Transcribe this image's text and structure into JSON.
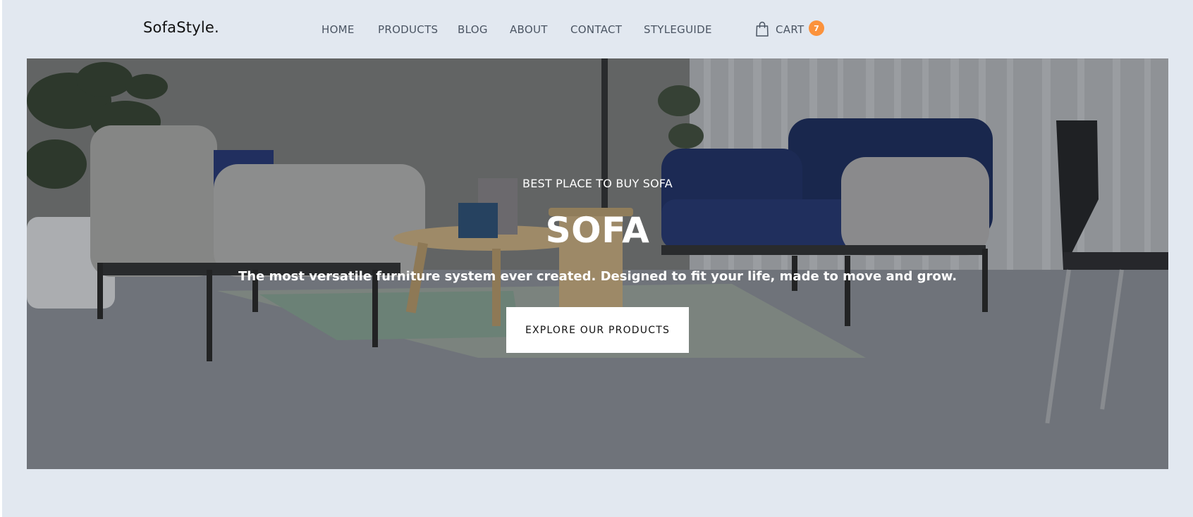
{
  "brand": {
    "logo": "SofaStyle."
  },
  "nav": {
    "items": [
      {
        "label": "HOME"
      },
      {
        "label": "PRODUCTS"
      },
      {
        "label": "BLOG"
      },
      {
        "label": "ABOUT"
      },
      {
        "label": "CONTACT"
      },
      {
        "label": "STYLEGUIDE"
      }
    ]
  },
  "cart": {
    "label": "CART",
    "count": "7",
    "icon": "shopping-bag-icon"
  },
  "hero": {
    "eyebrow": "BEST PLACE TO BUY SOFA",
    "title": "SOFA",
    "subtitle": "The most versatile furniture system ever created. Designed to fit your life, made to move and grow.",
    "button_label": "EXPLORE OUR PRODUCTS"
  },
  "colors": {
    "page_background": "#e2e8f0",
    "badge": "#fb923c",
    "nav_text": "#4b5563"
  }
}
